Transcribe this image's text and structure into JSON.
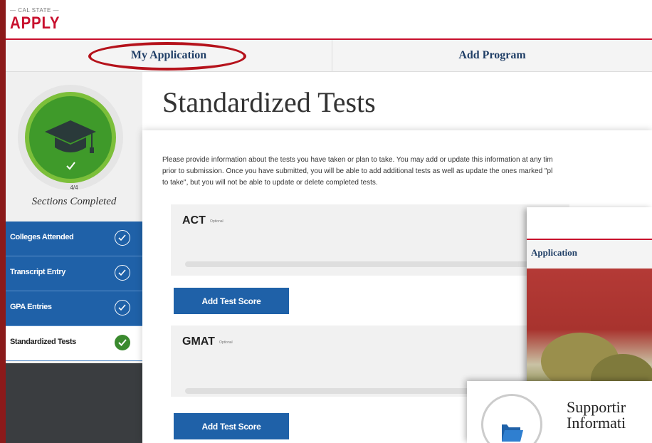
{
  "brand": {
    "top": "— CAL STATE —",
    "name": "APPLY"
  },
  "tabs": [
    "My Application",
    "Add Program"
  ],
  "sidebar": {
    "count": "4/4",
    "caption": "Sections Completed",
    "items": [
      {
        "label": "Colleges Attended",
        "active": false
      },
      {
        "label": "Transcript Entry",
        "active": false
      },
      {
        "label": "GPA Entries",
        "active": false
      },
      {
        "label": "Standardized Tests",
        "active": true
      }
    ]
  },
  "page": {
    "title": "Standardized Tests",
    "description": [
      "Please provide information about the tests you have taken or plan to take. You may add or update this information at any tim",
      "prior to submission. Once you have submitted, you will be able to add additional tests as well as update the ones marked \"pl",
      "to take\", but you will not be able to update or delete completed tests."
    ]
  },
  "tests": [
    {
      "name": "ACT",
      "optional": "Optional",
      "button": "Add Test Score"
    },
    {
      "name": "GMAT",
      "optional": "Optional",
      "button": "Add Test Score"
    }
  ],
  "overlay": {
    "tab": "Application",
    "support_title": [
      "Supportir",
      "Informati"
    ]
  },
  "colors": {
    "brand_red": "#c8102e",
    "nav_blue": "#1f61a8",
    "green": "#3f9a2a",
    "annotation_red": "#b5121b"
  }
}
